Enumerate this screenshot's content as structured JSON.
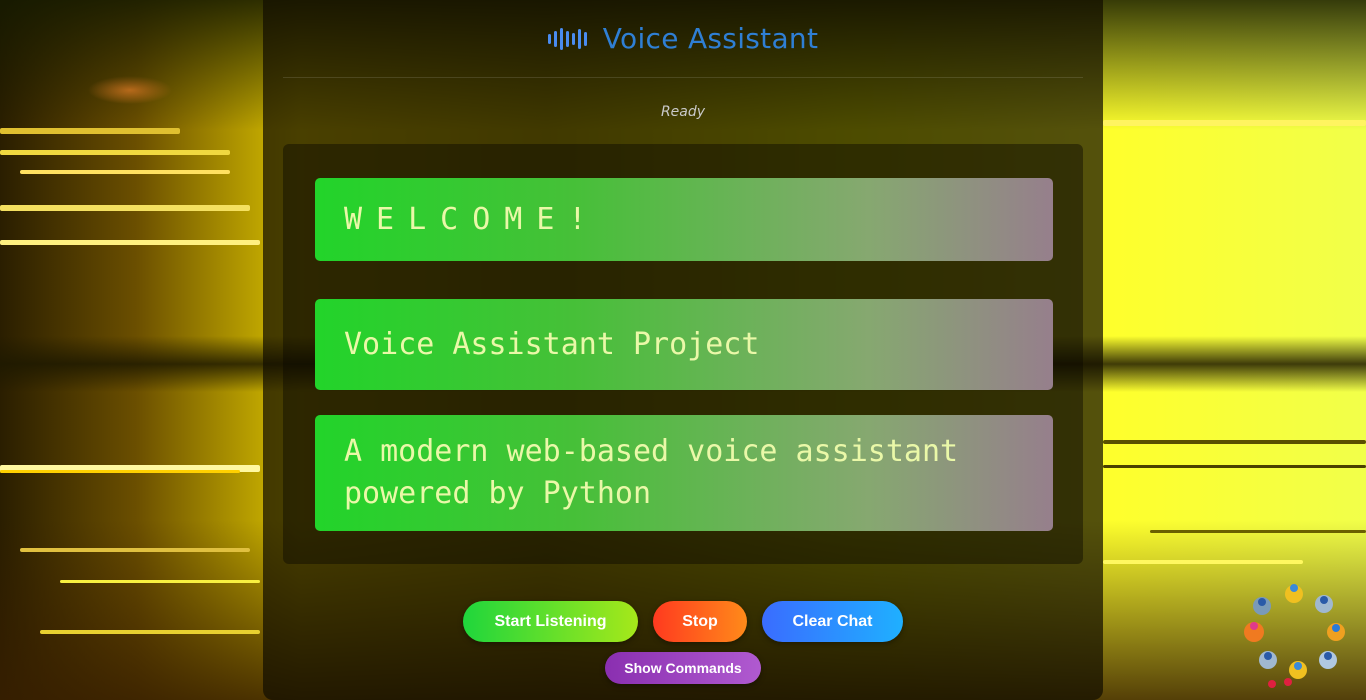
{
  "app": {
    "title": "Voice Assistant",
    "status": "Ready"
  },
  "icons": {
    "header_icon": "sound-wave-icon",
    "decoration": "robots-ring-icon"
  },
  "messages": [
    "WELCOME!",
    "Voice Assistant Project",
    "A modern web-based voice assistant powered by Python"
  ],
  "buttons": {
    "start": "Start Listening",
    "stop": "Stop",
    "clear": "Clear Chat",
    "commands": "Show Commands"
  },
  "colors": {
    "title": "#2f7fd4",
    "message_text": "#eaf8a8",
    "start": "#1fd63c",
    "stop": "#ff3a1f",
    "clear": "#3a6cff",
    "commands": "#8a2fb0"
  }
}
